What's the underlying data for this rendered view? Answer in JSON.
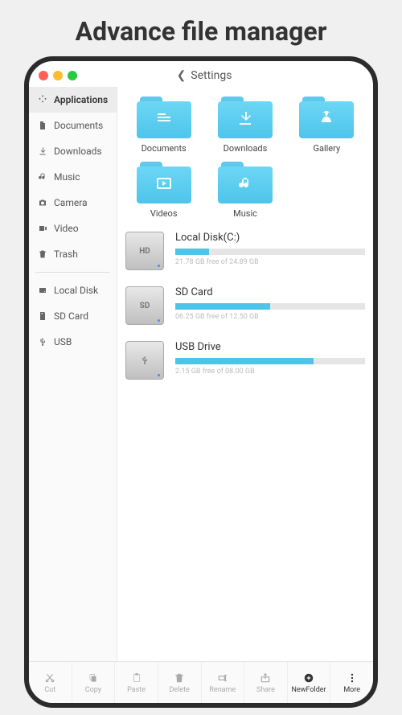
{
  "page_title": "Advance file manager",
  "header": {
    "title": "Settings"
  },
  "sidebar": {
    "main_items": [
      {
        "label": "Applications",
        "icon": "apps",
        "active": true
      },
      {
        "label": "Documents",
        "icon": "document",
        "active": false
      },
      {
        "label": "Downloads",
        "icon": "download",
        "active": false
      },
      {
        "label": "Music",
        "icon": "music",
        "active": false
      },
      {
        "label": "Camera",
        "icon": "camera",
        "active": false
      },
      {
        "label": "Video",
        "icon": "video",
        "active": false
      },
      {
        "label": "Trash",
        "icon": "trash",
        "active": false
      }
    ],
    "storage_items": [
      {
        "label": "Local Disk",
        "icon": "disk"
      },
      {
        "label": "SD Card",
        "icon": "sd"
      },
      {
        "label": "USB",
        "icon": "usb"
      }
    ]
  },
  "folders": [
    {
      "label": "Documents",
      "glyph": "doc"
    },
    {
      "label": "Downloads",
      "glyph": "download"
    },
    {
      "label": "Gallery",
      "glyph": "gallery"
    },
    {
      "label": "Videos",
      "glyph": "video"
    },
    {
      "label": "Music",
      "glyph": "music"
    }
  ],
  "drives": [
    {
      "name": "Local Disk(C:)",
      "tag": "HD",
      "free_text": "21.78 GB free of 24.89 GB",
      "fill_pct": 18
    },
    {
      "name": "SD Card",
      "tag": "SD",
      "free_text": "06.25 GB free of 12.50 GB",
      "fill_pct": 50
    },
    {
      "name": "USB Drive",
      "tag": "usb",
      "free_text": "2.15 GB free of 08.00 GB",
      "fill_pct": 73
    }
  ],
  "bottom_bar": [
    {
      "label": "Cut",
      "icon": "cut"
    },
    {
      "label": "Copy",
      "icon": "copy"
    },
    {
      "label": "Paste",
      "icon": "paste"
    },
    {
      "label": "Delete",
      "icon": "delete"
    },
    {
      "label": "Rename",
      "icon": "rename"
    },
    {
      "label": "Share",
      "icon": "share"
    },
    {
      "label": "NewFolder",
      "icon": "newfolder",
      "active": true
    },
    {
      "label": "More",
      "icon": "more",
      "active": true
    }
  ]
}
